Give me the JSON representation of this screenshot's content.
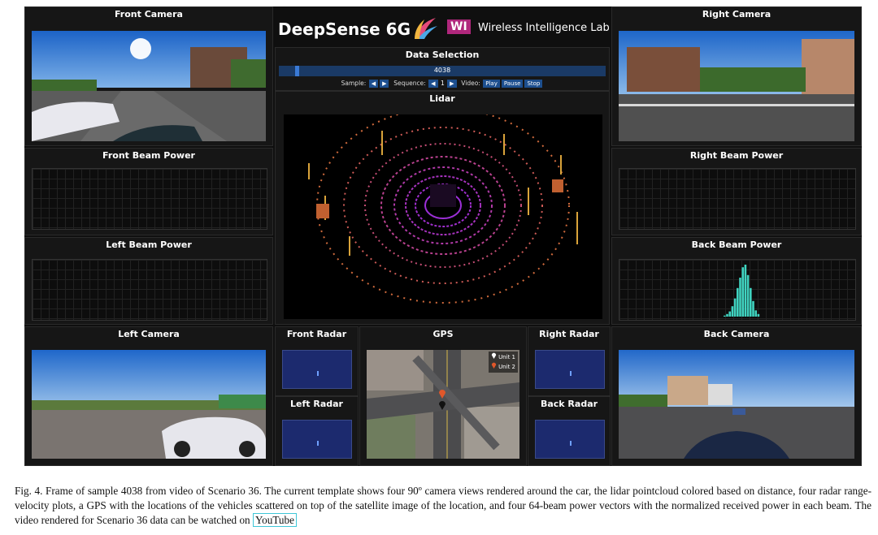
{
  "header": {
    "brand": "DeepSense 6G",
    "lab_logo": "WI",
    "lab": "Wireless Intelligence Lab"
  },
  "panels": {
    "front_camera": "Front Camera",
    "right_camera": "Right Camera",
    "front_beam": "Front Beam Power",
    "right_beam": "Right Beam Power",
    "left_beam": "Left Beam Power",
    "back_beam": "Back Beam Power",
    "left_camera": "Left Camera",
    "back_camera": "Back Camera",
    "front_radar": "Front Radar",
    "left_radar": "Left Radar",
    "gps": "GPS",
    "right_radar": "Right Radar",
    "back_radar": "Back Radar",
    "lidar": "Lidar"
  },
  "data_selection": {
    "title": "Data Selection",
    "slider_value": "4038",
    "slider_fraction": 0.05,
    "sample_label": "Sample:",
    "sequence_label": "Sequence:",
    "sequence_value": "1",
    "video_label": "Video:",
    "play": "Play",
    "pause": "Pause",
    "stop": "Stop"
  },
  "gps_legend": {
    "unit1": "Unit 1",
    "unit2": "Unit 2"
  },
  "back_beam_power": [
    0.02,
    0.05,
    0.1,
    0.2,
    0.35,
    0.55,
    0.75,
    0.95,
    1.0,
    0.8,
    0.55,
    0.3,
    0.12,
    0.05
  ],
  "caption": {
    "text": "Fig. 4.  Frame of sample 4038 from video of Scenario 36. The current template shows four 90º camera views rendered around the car, the lidar pointcloud colored based on distance, four radar range-velocity plots, a GPS with the locations of the vehicles scattered on top of the satellite image of the location, and four 64-beam power vectors with the normalized received power in each beam. The video rendered for Scenario 36 data can be watched on",
    "link": "YouTube"
  },
  "colors": {
    "button_blue": "#1d4f8f",
    "beam_bar": "#3fd3c0",
    "radar_bg": "#1c2a6e"
  }
}
